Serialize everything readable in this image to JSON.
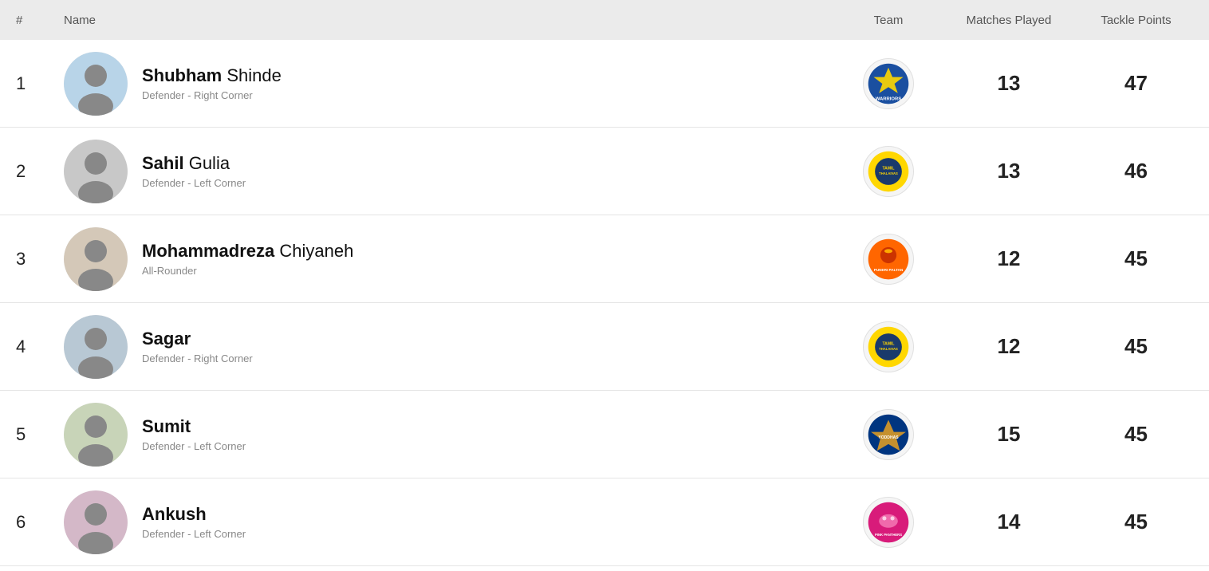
{
  "header": {
    "rank_label": "#",
    "name_label": "Name",
    "team_label": "Team",
    "matches_label": "Matches Played",
    "points_label": "Tackle Points"
  },
  "rows": [
    {
      "rank": "1",
      "first_name": "Shubham",
      "last_name": "Shinde",
      "role": "Defender - Right Corner",
      "team": "Warriors",
      "team_abbr": "Warriors",
      "matches": "13",
      "points": "47"
    },
    {
      "rank": "2",
      "first_name": "Sahil",
      "last_name": "Gulia",
      "role": "Defender - Left Corner",
      "team": "Tamil Thalaivas",
      "team_abbr": "Tamil\nThalaivas",
      "matches": "13",
      "points": "46"
    },
    {
      "rank": "3",
      "first_name": "Mohammadreza",
      "last_name": "Chiyaneh",
      "role": "All-Rounder",
      "team": "Puneri Paltan",
      "team_abbr": "Puneri\nPaltan",
      "matches": "12",
      "points": "45"
    },
    {
      "rank": "4",
      "first_name": "Sagar",
      "last_name": "",
      "role": "Defender - Right Corner",
      "team": "Tamil Thalaivas",
      "team_abbr": "Tamil\nThalaivas",
      "matches": "12",
      "points": "45"
    },
    {
      "rank": "5",
      "first_name": "Sumit",
      "last_name": "",
      "role": "Defender - Left Corner",
      "team": "UP Yoddhas",
      "team_abbr": "UP\nYoddhas",
      "matches": "15",
      "points": "45"
    },
    {
      "rank": "6",
      "first_name": "Ankush",
      "last_name": "",
      "role": "Defender - Left Corner",
      "team": "Jaipur Pink Panthers",
      "team_abbr": "Pink\nPanthers",
      "matches": "14",
      "points": "45"
    }
  ],
  "team_colors": {
    "Warriors": "#1a4fa0",
    "Tamil Thalaivas": "#1a3a6b",
    "Puneri Paltan": "#cc4400",
    "UP Yoddhas": "#003580",
    "Jaipur Pink Panthers": "#d81b7a"
  }
}
